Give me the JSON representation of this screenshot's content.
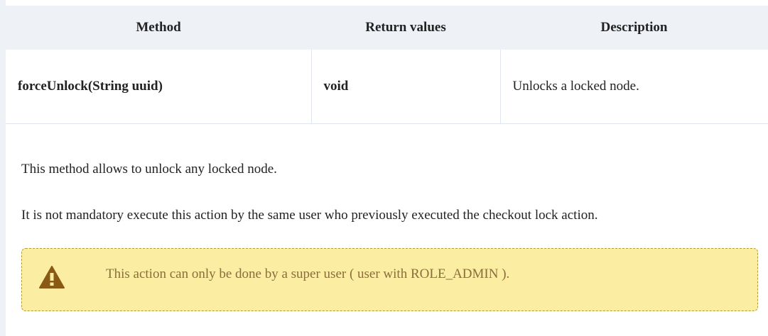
{
  "table": {
    "headers": [
      "Method",
      "Return values",
      "Description"
    ],
    "rows": [
      {
        "method": "forceUnlock(String uuid)",
        "return_value": "void",
        "description": "Unlocks a locked node."
      }
    ]
  },
  "paragraphs": [
    "This method allows to unlock any locked node.",
    "It is not mandatory execute this action by the same user who previously executed the checkout lock action."
  ],
  "warning": {
    "icon": "warning-icon",
    "text": "This action can only be done by a super user ( user with ROLE_ADMIN )."
  },
  "colors": {
    "header_bg": "#eef1f6",
    "warning_bg": "#fbeea3",
    "warning_border": "#b39b3c",
    "warning_text": "#8a6d3b",
    "warning_icon": "#8a5a14"
  }
}
